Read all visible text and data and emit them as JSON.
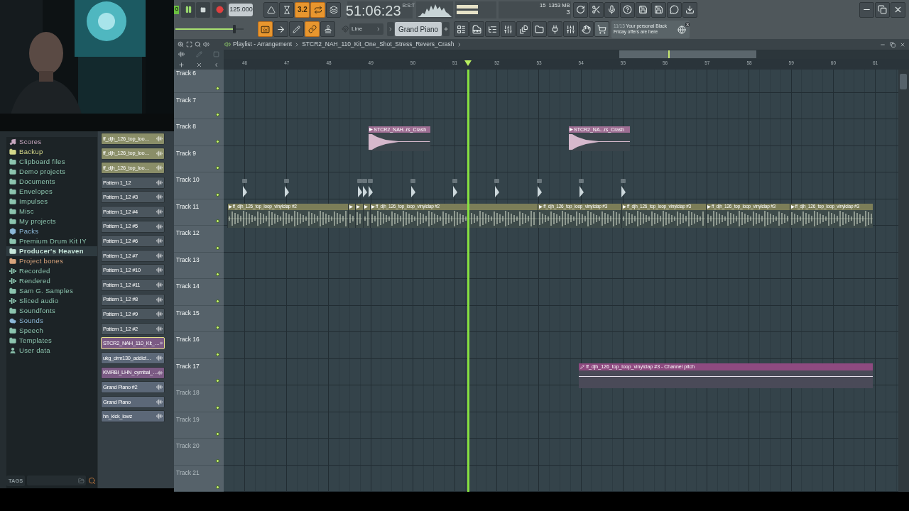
{
  "transport": {
    "pattern_tag": "G",
    "playing": true,
    "tempo": "125.000",
    "time": "51:06:23",
    "time_unit": "B:S:T"
  },
  "toggles_top": [
    {
      "kind": "metronome",
      "on": false
    },
    {
      "kind": "wait",
      "on": false
    },
    {
      "kind": "countdown",
      "label": "3.2",
      "on": true
    },
    {
      "kind": "loop_record",
      "on": true
    },
    {
      "kind": "blend",
      "on": false
    }
  ],
  "toggles_bottom": [
    {
      "kind": "typing_keyboard",
      "on": true
    },
    {
      "kind": "arrow",
      "on": false
    },
    {
      "kind": "snap",
      "on": false
    },
    {
      "kind": "link",
      "on": true
    },
    {
      "kind": "stamp",
      "on": false
    }
  ],
  "master_volume": {
    "level": 0.86
  },
  "monitor": {
    "cpu": "15",
    "memory": "1353 MB",
    "polyphony": "3"
  },
  "snap_mode": {
    "value": "Line"
  },
  "pattern_selector": {
    "value": "Grand Piano"
  },
  "news": {
    "counter": "11/13",
    "text": "Your personal Black Friday offers are here",
    "badge": "3"
  },
  "browser": {
    "items": [
      {
        "label": "Scores",
        "kind": "scores",
        "color": "#c8a8c0",
        "selected": false
      },
      {
        "label": "Backup",
        "kind": "folder",
        "color": "#d4d88a",
        "selected": false
      },
      {
        "label": "Clipboard files",
        "kind": "folder",
        "color": "#8cc4ae",
        "selected": false
      },
      {
        "label": "Demo projects",
        "kind": "folder",
        "color": "#8cc4ae",
        "selected": false
      },
      {
        "label": "Documents",
        "kind": "folder",
        "color": "#8cc4ae",
        "selected": false
      },
      {
        "label": "Envelopes",
        "kind": "folder",
        "color": "#8cc4ae",
        "selected": false
      },
      {
        "label": "Impulses",
        "kind": "folder",
        "color": "#8cc4ae",
        "selected": false
      },
      {
        "label": "Misc",
        "kind": "folder",
        "color": "#8cc4ae",
        "selected": false
      },
      {
        "label": "My projects",
        "kind": "folder",
        "color": "#8cc4ae",
        "selected": false
      },
      {
        "label": "Packs",
        "kind": "packs",
        "color": "#8cb8d8",
        "selected": false
      },
      {
        "label": "Premium Drum Kit IY",
        "kind": "folder",
        "color": "#8cc4ae",
        "selected": false
      },
      {
        "label": "Producer's Heaven",
        "kind": "folder",
        "color": "#c8e8dc",
        "selected": true
      },
      {
        "label": "Project bones",
        "kind": "folder",
        "color": "#d8a47c",
        "selected": false
      },
      {
        "label": "Recorded",
        "kind": "recorded",
        "color": "#8cc4ae",
        "selected": false
      },
      {
        "label": "Rendered",
        "kind": "rendered",
        "color": "#8cc4ae",
        "selected": false
      },
      {
        "label": "Sam G. Samples",
        "kind": "folder",
        "color": "#8cc4ae",
        "selected": false
      },
      {
        "label": "Sliced audio",
        "kind": "recorded",
        "color": "#8cc4ae",
        "selected": false
      },
      {
        "label": "Soundfonts",
        "kind": "folder",
        "color": "#8cc4ae",
        "selected": false
      },
      {
        "label": "Sounds",
        "kind": "cloud",
        "color": "#8cb8d8",
        "selected": false
      },
      {
        "label": "Speech",
        "kind": "folder",
        "color": "#8cc4ae",
        "selected": false
      },
      {
        "label": "Templates",
        "kind": "folder",
        "color": "#8cc4ae",
        "selected": false
      },
      {
        "label": "User data",
        "kind": "user",
        "color": "#8cc4ae",
        "selected": false
      }
    ],
    "tags_label": "TAGS"
  },
  "channels": [
    {
      "name": "ff_djh_126_top_loo…",
      "color": "#8a8e68",
      "selected": false
    },
    {
      "name": "ff_djh_126_top_loo…",
      "color": "#8a8e68",
      "selected": false
    },
    {
      "name": "ff_djh_126_top_loo…",
      "color": "#8a8e68",
      "selected": false
    },
    {
      "name": "Pattern 1_12",
      "color": "#4b565e",
      "selected": false
    },
    {
      "name": "Pattern 1_12 #3",
      "color": "#4b565e",
      "selected": false
    },
    {
      "name": "Pattern 1_12 #4",
      "color": "#4b565e",
      "selected": false
    },
    {
      "name": "Pattern 1_12 #5",
      "color": "#4b565e",
      "selected": false
    },
    {
      "name": "Pattern 1_12 #6",
      "color": "#4b565e",
      "selected": false
    },
    {
      "name": "Pattern 1_12 #7",
      "color": "#4b565e",
      "selected": false
    },
    {
      "name": "Pattern 1_12 #10",
      "color": "#4b565e",
      "selected": false
    },
    {
      "name": "Pattern 1_12 #11",
      "color": "#4b565e",
      "selected": false
    },
    {
      "name": "Pattern 1_12 #8",
      "color": "#4b565e",
      "selected": false
    },
    {
      "name": "Pattern 1_12 #9",
      "color": "#4b565e",
      "selected": false
    },
    {
      "name": "Pattern 1_12 #2",
      "color": "#4b565e",
      "selected": false
    },
    {
      "name": "STCR2_NAH_110_Kit_…",
      "color": "#7b5a84",
      "selected": true
    },
    {
      "name": "ukg_drm130_addict…",
      "color": "#5c6878",
      "selected": false
    },
    {
      "name": "KMRBI_LHN_cymbal_…",
      "color": "#7b5a84",
      "selected": false
    },
    {
      "name": "Grand Piano #2",
      "color": "#5c6878",
      "selected": false
    },
    {
      "name": "Grand Piano",
      "color": "#5c6878",
      "selected": false
    },
    {
      "name": "hn_kick_lowz",
      "color": "#5c6878",
      "selected": false
    }
  ],
  "playlist": {
    "title": "Playlist - Arrangement",
    "breadcrumb": "STCR2_NAH_110_Kit_One_Shot_Stress_Revers_Crash",
    "bars": [
      "46",
      "47",
      "48",
      "49",
      "50",
      "51",
      "52",
      "53",
      "54",
      "55",
      "56",
      "57",
      "58",
      "59",
      "60",
      "61"
    ],
    "tracks": [
      {
        "name": "Track 6",
        "dimmed": false,
        "active": true
      },
      {
        "name": "Track 7",
        "dimmed": false,
        "active": true
      },
      {
        "name": "Track 8",
        "dimmed": false,
        "active": true,
        "clips": [
          {
            "kind": "oneshot",
            "name": "STCR2_NAH..rs_Crash"
          },
          {
            "kind": "oneshot",
            "name": "STCR2_NA...rs_Crash"
          }
        ]
      },
      {
        "name": "Track 9",
        "dimmed": false,
        "active": true
      },
      {
        "name": "Track 10",
        "dimmed": false,
        "active": true,
        "clips": [
          {
            "kind": "marker"
          },
          {
            "kind": "marker"
          },
          {
            "kind": "marker"
          },
          {
            "kind": "marker"
          },
          {
            "kind": "marker"
          },
          {
            "kind": "marker"
          },
          {
            "kind": "marker"
          },
          {
            "kind": "marker"
          },
          {
            "kind": "marker"
          },
          {
            "kind": "marker"
          },
          {
            "kind": "marker"
          }
        ]
      },
      {
        "name": "Track 11",
        "dimmed": false,
        "active": true,
        "clips": [
          {
            "kind": "loop",
            "name": "ff_djh_126_top_loop_vinylclap #2"
          },
          {
            "kind": "loop_stub"
          },
          {
            "kind": "loop_stub"
          },
          {
            "kind": "loop_stub"
          },
          {
            "kind": "loop",
            "name": "ff_djh_126_top_loop_vinylclap #2"
          },
          {
            "kind": "loop",
            "name": "ff_djh_126_top_loop_vinylclap #3"
          },
          {
            "kind": "loop",
            "name": "ff_djh_126_top_loop_vinylclap #3"
          },
          {
            "kind": "loop",
            "name": "ff_djh_126_top_loop_vinylclap #3"
          },
          {
            "kind": "loop",
            "name": "ff_djh_126_top_loop_vinylclap #3"
          }
        ]
      },
      {
        "name": "Track 12",
        "dimmed": false,
        "active": true
      },
      {
        "name": "Track 13",
        "dimmed": false,
        "active": true
      },
      {
        "name": "Track 14",
        "dimmed": false,
        "active": true
      },
      {
        "name": "Track 15",
        "dimmed": false,
        "active": true
      },
      {
        "name": "Track 16",
        "dimmed": false,
        "active": true
      },
      {
        "name": "Track 17",
        "dimmed": false,
        "active": true,
        "clips": [
          {
            "kind": "automation",
            "name": "ff_djh_126_top_loop_vinylclap #3 - Channel pitch"
          }
        ]
      },
      {
        "name": "Track 18",
        "dimmed": true,
        "active": true
      },
      {
        "name": "Track 19",
        "dimmed": true,
        "active": true
      },
      {
        "name": "Track 20",
        "dimmed": true,
        "active": true
      },
      {
        "name": "Track 21",
        "dimmed": true,
        "active": true
      }
    ]
  }
}
